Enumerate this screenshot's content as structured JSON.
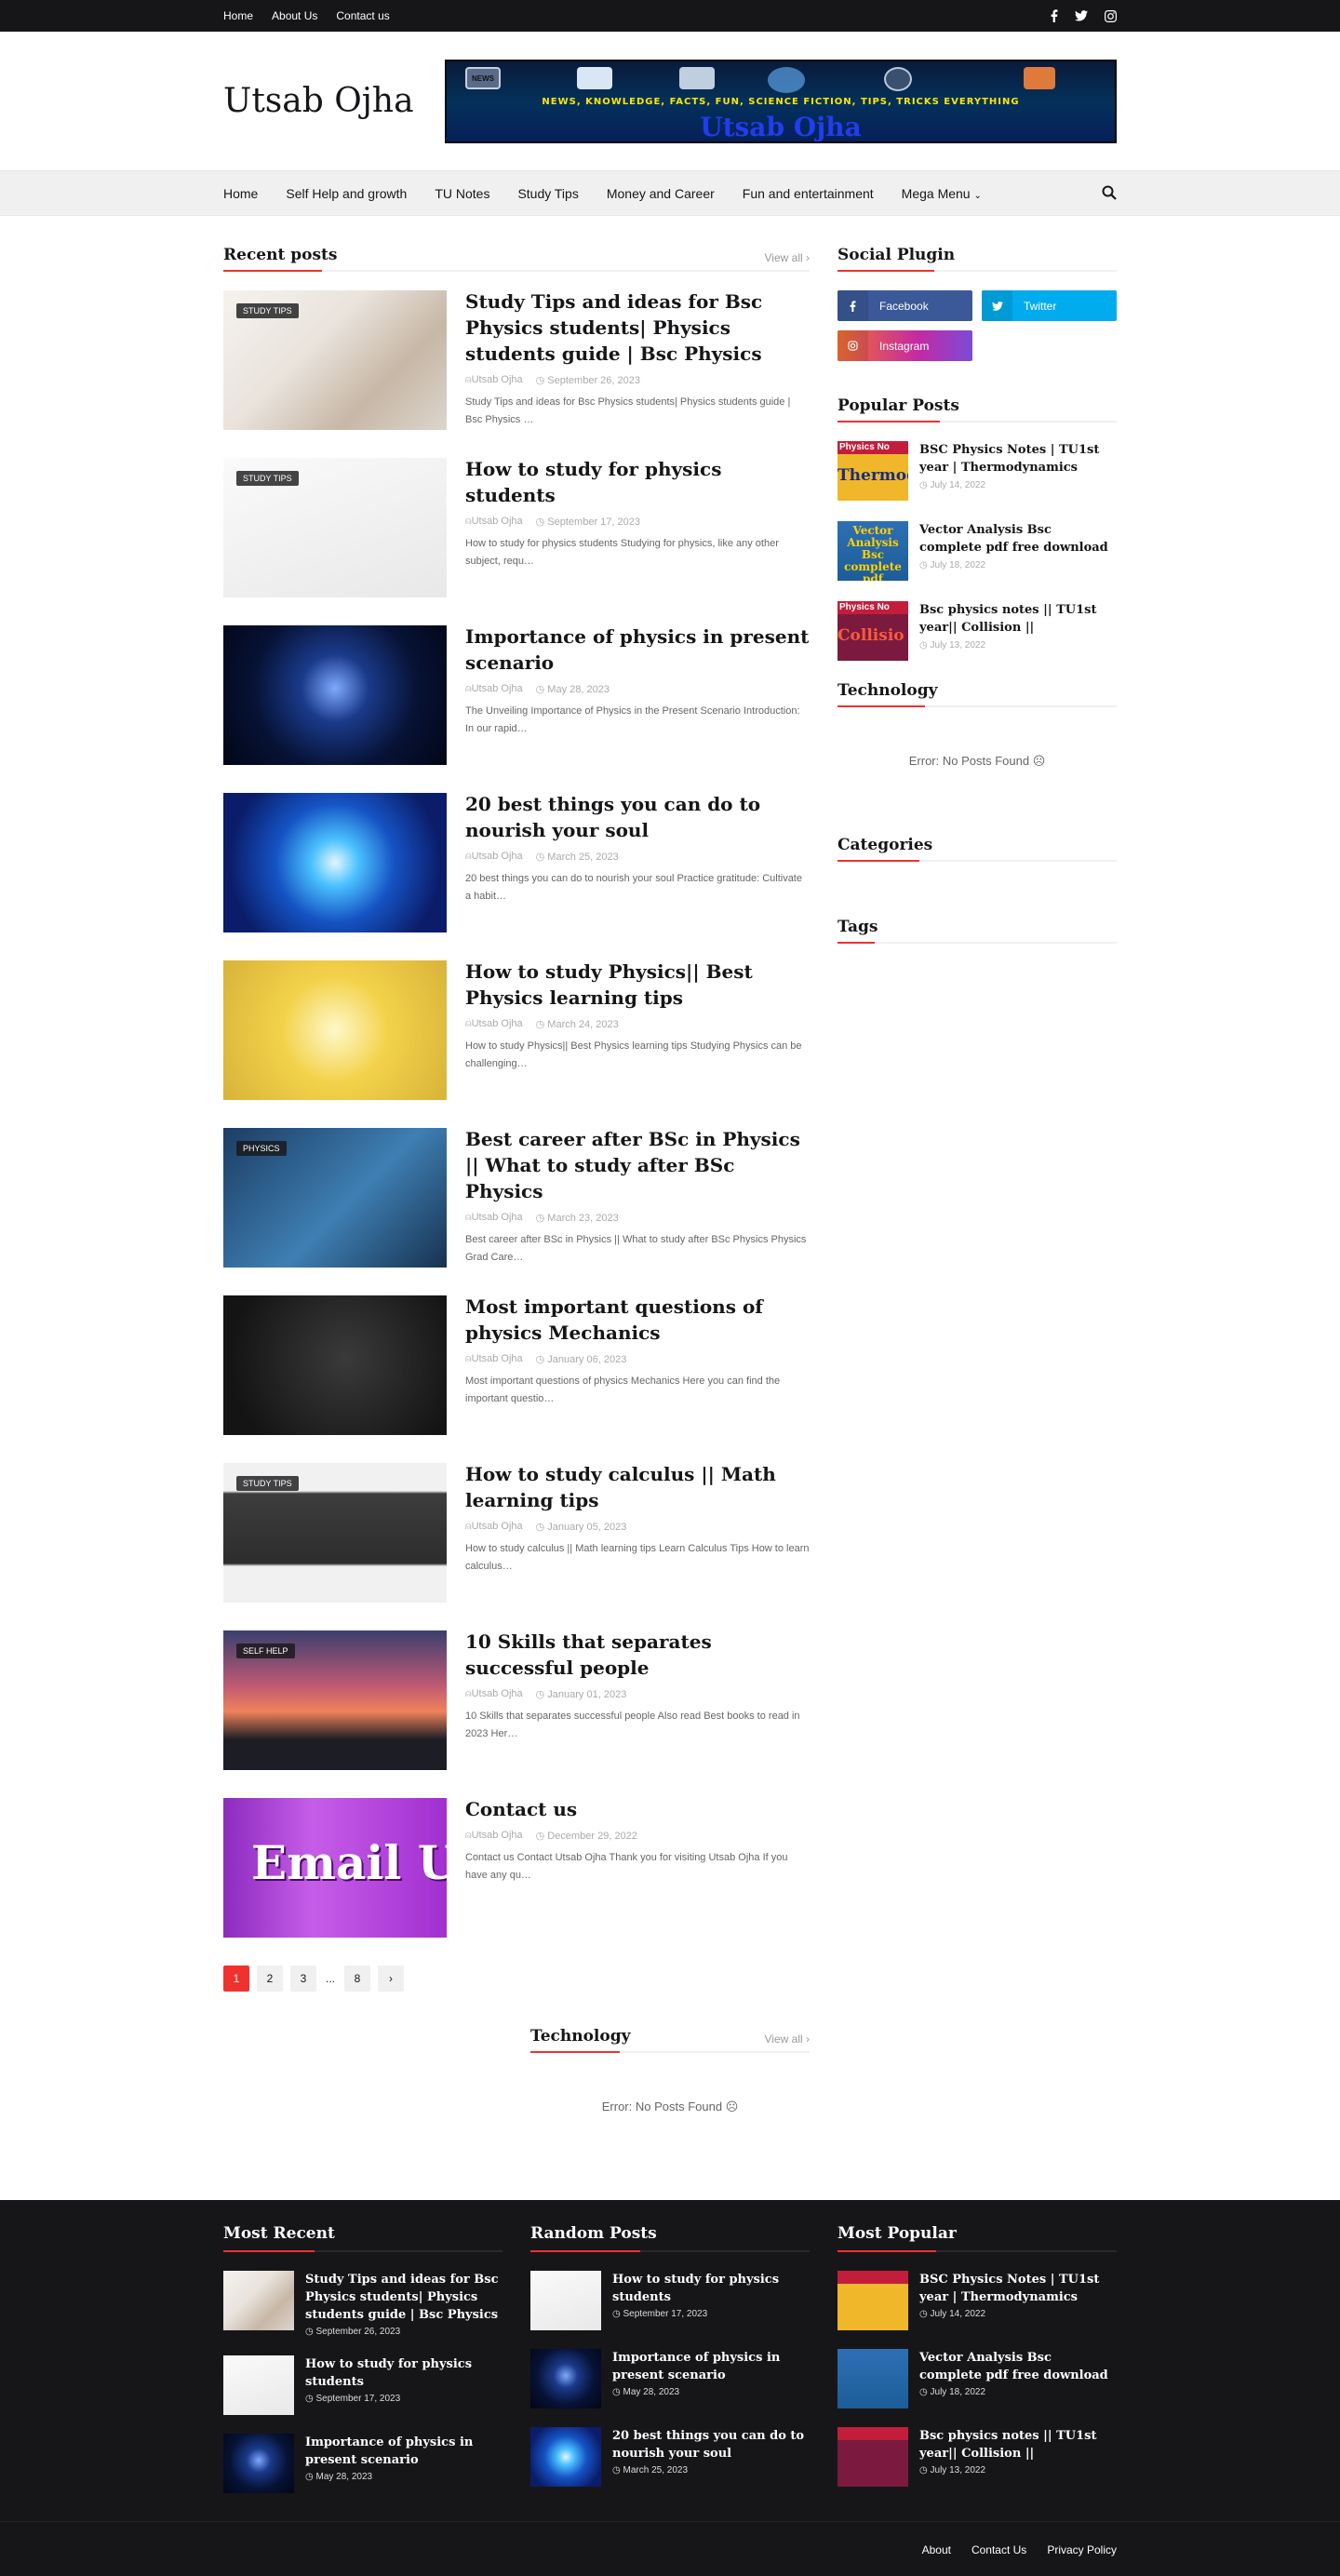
{
  "topbar": {
    "links": [
      "Home",
      "About Us",
      "Contact us"
    ],
    "social_icons": [
      "facebook-icon",
      "twitter-icon",
      "instagram-icon"
    ]
  },
  "header": {
    "logo": "Utsab Ojha",
    "banner_tagline": "NEWS, KNOWLEDGE, FACTS, FUN, SCIENCE FICTION, TIPS, TRICKS EVERYTHING",
    "banner_title": "Utsab Ojha",
    "banner_badge": "NEWS"
  },
  "nav": {
    "items": [
      "Home",
      "Self Help and growth",
      "TU Notes",
      "Study Tips",
      "Money and Career",
      "Fun and entertainment",
      "Mega Menu"
    ],
    "search_icon": "search-icon"
  },
  "recent": {
    "title": "Recent posts",
    "view_all": "View all",
    "posts": [
      {
        "label": "STUDY TIPS",
        "title": "Study Tips and ideas for Bsc Physics students| Physics students guide | Bsc Physics",
        "author": "Utsab Ojha",
        "date": "September 26, 2023",
        "snippet": "Study Tips and ideas for Bsc Physics students| Physics students guide | Bsc Physics  …"
      },
      {
        "label": "STUDY TIPS",
        "title": "How to study for physics students",
        "author": "Utsab Ojha",
        "date": "September 17, 2023",
        "snippet": "How to study for physics students Studying for physics, like any other subject, requ…"
      },
      {
        "label": "",
        "title": "Importance of physics in present scenario",
        "author": "Utsab Ojha",
        "date": "May 28, 2023",
        "snippet": "The Unveiling Importance of Physics in the Present Scenario Introduction: In our rapid…"
      },
      {
        "label": "",
        "title": "20 best things you can do to nourish your soul",
        "author": "Utsab Ojha",
        "date": "March 25, 2023",
        "snippet": "20 best things you can do to nourish your soul Practice gratitude: Cultivate a habit…"
      },
      {
        "label": "",
        "title": "How to study Physics|| Best Physics learning tips",
        "author": "Utsab Ojha",
        "date": "March 24, 2023",
        "snippet": "How to study Physics|| Best Physics learning tips Studying Physics can be challenging…"
      },
      {
        "label": "PHYSICS",
        "title": "Best career after BSc in Physics || What to study after BSc Physics",
        "author": "Utsab Ojha",
        "date": "March 23, 2023",
        "snippet": "Best career after BSc in Physics || What to study after BSc Physics Physics Grad Care…"
      },
      {
        "label": "",
        "title": "Most important questions of physics Mechanics",
        "author": "Utsab Ojha",
        "date": "January 06, 2023",
        "snippet": "Most important questions of physics Mechanics  Here you can find the important questio…"
      },
      {
        "label": "STUDY TIPS",
        "title": "How to study calculus || Math learning tips",
        "author": "Utsab Ojha",
        "date": "January 05, 2023",
        "snippet": "How to study calculus || Math learning tips Learn Calculus Tips How to learn calculus…"
      },
      {
        "label": "SELF HELP",
        "title": "10 Skills that separates successful people",
        "author": "Utsab Ojha",
        "date": "January 01, 2023",
        "snippet": "10 Skills that separates successful people Also read  Best books to read in 2023 Her…"
      },
      {
        "label": "",
        "title": "Contact us",
        "author": "Utsab Ojha",
        "date": "December 29, 2022",
        "snippet": "Contact us Contact Utsab Ojha Thank you for visiting Utsab Ojha    If you have any qu…"
      }
    ],
    "email_art_text": "Email U"
  },
  "pager": {
    "pages": [
      "1",
      "2",
      "3",
      "...",
      "8"
    ],
    "current": "1",
    "next_icon": "chevron-right-icon"
  },
  "technology_main": {
    "title": "Technology",
    "view_all": "View all",
    "error": "Error: No Posts Found ☹"
  },
  "sidebar": {
    "social_title": "Social Plugin",
    "social_buttons": [
      {
        "label": "Facebook",
        "color": "#3b5999"
      },
      {
        "label": "Twitter",
        "color": "#00acee"
      },
      {
        "label": "Instagram",
        "color": "#dd277b"
      }
    ],
    "popular_title": "Popular Posts",
    "popular": [
      {
        "title": "BSC Physics Notes | TU1st year | Thermodynamics",
        "date": "July 14, 2022",
        "thumb_text": "Thermodynam"
      },
      {
        "title": "Vector Analysis Bsc complete pdf free download",
        "date": "July 18, 2022",
        "thumb_text": "Vector Analysis Bsc complete pdf"
      },
      {
        "title": "Bsc physics notes || TU1st year|| Collision ||",
        "date": "July 13, 2022",
        "thumb_text": "Collisio"
      }
    ],
    "thumb_banner": "Physics No",
    "technology_title": "Technology",
    "technology_error": "Error: No Posts Found ☹",
    "categories_title": "Categories",
    "tags_title": "Tags"
  },
  "footer": {
    "most_recent_title": "Most Recent",
    "most_recent": [
      {
        "title": "Study Tips and ideas for Bsc Physics students| Physics students guide | Bsc Physics",
        "date": "September 26, 2023"
      },
      {
        "title": "How to study for physics students",
        "date": "September 17, 2023"
      },
      {
        "title": "Importance of physics in present scenario",
        "date": "May 28, 2023"
      }
    ],
    "random_title": "Random Posts",
    "random": [
      {
        "title": "How to study for physics students",
        "date": "September 17, 2023"
      },
      {
        "title": "Importance of physics in present scenario",
        "date": "May 28, 2023"
      },
      {
        "title": "20 best things you can do to nourish your soul",
        "date": "March 25, 2023"
      }
    ],
    "popular_title": "Most Popular",
    "popular": [
      {
        "title": "BSC Physics Notes | TU1st year | Thermodynamics",
        "date": "July 14, 2022"
      },
      {
        "title": "Vector Analysis Bsc complete pdf free download",
        "date": "July 18, 2022"
      },
      {
        "title": "Bsc physics notes || TU1st year|| Collision ||",
        "date": "July 13, 2022"
      }
    ],
    "bottom_links": [
      "About",
      "Contact Us",
      "Privacy Policy"
    ]
  }
}
